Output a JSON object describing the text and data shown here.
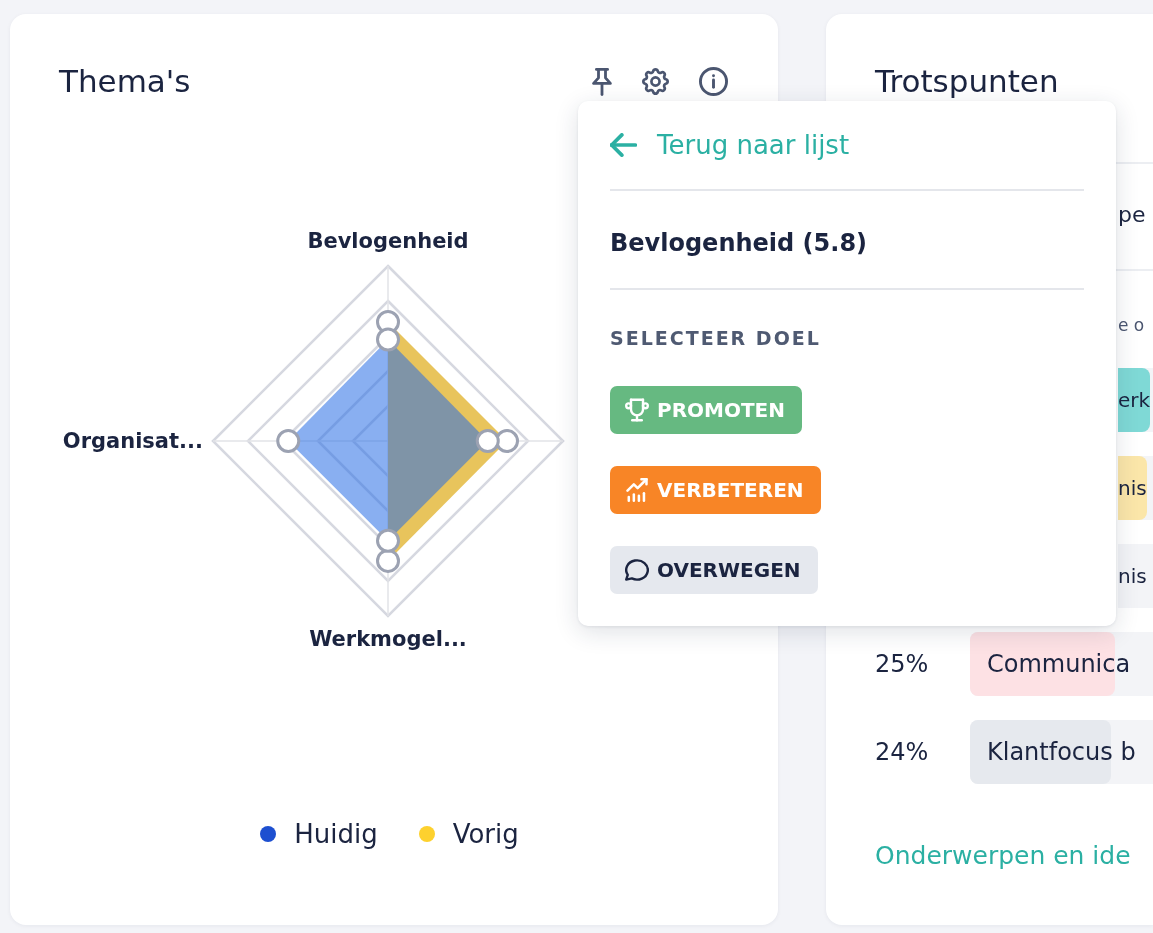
{
  "themes_card": {
    "title": "Thema's",
    "radar_chart": {
      "axis_labels": {
        "top": "Bevlogenheid",
        "left": "Organisat...",
        "bottom": "Werkmogel..."
      },
      "legend": [
        {
          "label": "Huidig",
          "color": "#1d4fd0"
        },
        {
          "label": "Vorig",
          "color": "#fdd12e"
        }
      ]
    }
  },
  "popup": {
    "back_link": "Terug naar lijst",
    "heading": "Bevlogenheid (5.8)",
    "section_label": "SELECTEER DOEL",
    "goals": [
      {
        "label": "PROMOTEN",
        "kind": "promote",
        "color": "#66b981"
      },
      {
        "label": "VERBETEREN",
        "kind": "improve",
        "color": "#f88526"
      },
      {
        "label": "OVERWEGEN",
        "kind": "consider",
        "color": "#e5e8ee"
      }
    ]
  },
  "trotspunten_card": {
    "title": "Trotspunten",
    "text_1": "pe",
    "text_2": "e o",
    "rows": [
      {
        "kind": "partial",
        "label": "erk",
        "color": "#7fd9d6"
      },
      {
        "kind": "partial",
        "label": "nis",
        "color": "#fbe6a9"
      },
      {
        "kind": "partial",
        "label": "nis"
      },
      {
        "kind": "full",
        "percent": "25%",
        "label": "Communica",
        "color": "#fde1e4",
        "level": 0.79
      },
      {
        "kind": "full",
        "percent": "24%",
        "label": "Klantfocus b",
        "color": "#e6e9ee",
        "level": 0.77
      }
    ],
    "link": "Onderwerpen en ide"
  }
}
